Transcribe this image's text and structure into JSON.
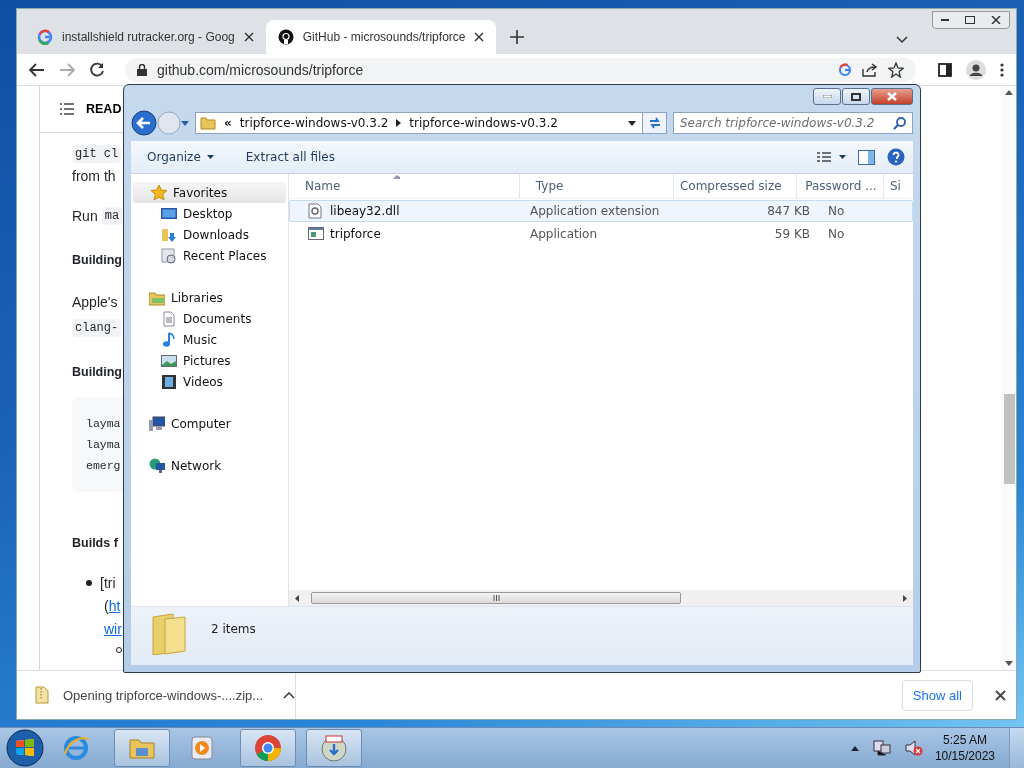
{
  "browser": {
    "tabs": [
      {
        "title": "installshield rutracker.org - Goog",
        "kind": "google",
        "selected": false
      },
      {
        "title": "GitHub - microsounds/tripforce",
        "kind": "github",
        "selected": true
      }
    ],
    "address": "github.com/microsounds/tripforce",
    "page": {
      "toc_label": "READ",
      "blocks": [
        {
          "kind": "code",
          "text": "git cl"
        },
        {
          "kind": "text",
          "text": "from th"
        },
        {
          "kind": "mixed",
          "text": "Run",
          "code": "ma"
        },
        {
          "kind": "heading",
          "text": "Building"
        },
        {
          "kind": "text",
          "text": "Apple's"
        },
        {
          "kind": "code",
          "text": "clang-"
        },
        {
          "kind": "heading",
          "text": "Building"
        },
        {
          "kind": "codeblock",
          "lines": [
            "layma",
            "layma",
            "emerg"
          ]
        },
        {
          "kind": "heading",
          "text": "Builds f"
        },
        {
          "kind": "bullet",
          "text": "[tri"
        },
        {
          "kind": "link",
          "prefix": "(",
          "text": "ht"
        },
        {
          "kind": "link",
          "text": "wir"
        },
        {
          "kind": "subbullet"
        }
      ]
    },
    "download": {
      "file": "Opening tripforce-windows-....zip...",
      "show_all": "Show all"
    }
  },
  "explorer": {
    "overflow_marker": "«",
    "crumbs": [
      "tripforce-windows-v0.3.2",
      "tripforce-windows-v0.3.2"
    ],
    "search_placeholder": "Search tripforce-windows-v0.3.2",
    "toolbar": [
      {
        "label": "Organize",
        "dropdown": true
      },
      {
        "label": "Extract all files",
        "dropdown": false
      }
    ],
    "nav": [
      {
        "label": "Favorites",
        "selected": true,
        "children": [
          {
            "label": "Desktop",
            "selected": false
          },
          {
            "label": "Downloads",
            "selected": false
          },
          {
            "label": "Recent Places",
            "selected": false
          }
        ]
      },
      {
        "label": "Libraries",
        "selected": false,
        "children": [
          {
            "label": "Documents",
            "selected": false
          },
          {
            "label": "Music",
            "selected": false
          },
          {
            "label": "Pictures",
            "selected": false
          },
          {
            "label": "Videos",
            "selected": false
          }
        ]
      },
      {
        "label": "Computer",
        "selected": false
      },
      {
        "label": "Network",
        "selected": false
      }
    ],
    "columns": [
      "Name",
      "Type",
      "Compressed size",
      "Password ...",
      "Si"
    ],
    "files": [
      {
        "name": "libeay32.dll",
        "kind": "library",
        "type": "Application extension",
        "size": "847 KB",
        "password": "No",
        "hovered": true
      },
      {
        "name": "tripforce",
        "kind": "application",
        "type": "Application",
        "size": "59 KB",
        "password": "No",
        "hovered": false
      }
    ],
    "status": "2 items"
  },
  "taskbar": {
    "apps": [
      {
        "kind": "ie",
        "active": false
      },
      {
        "kind": "folder",
        "active": true
      },
      {
        "kind": "media",
        "active": false
      },
      {
        "kind": "chrome",
        "active": true
      },
      {
        "kind": "installer",
        "active": true
      }
    ],
    "time": "5:25 AM",
    "date": "10/15/2023"
  }
}
